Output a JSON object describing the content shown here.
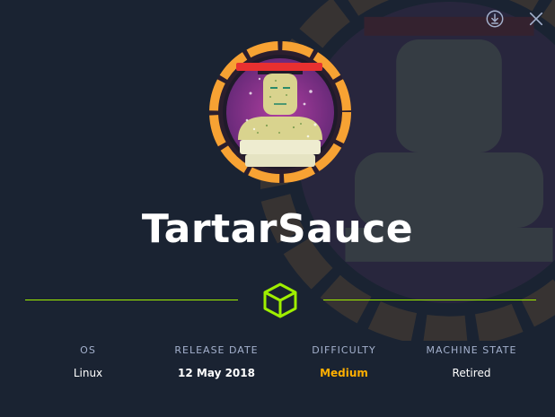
{
  "machine": {
    "name": "TartarSauce"
  },
  "stats": [
    {
      "label": "OS",
      "value": "Linux"
    },
    {
      "label": "RELEASE DATE",
      "value": "12 May 2018"
    },
    {
      "label": "DIFFICULTY",
      "value": "Medium"
    },
    {
      "label": "MACHINE STATE",
      "value": "Retired"
    }
  ],
  "icons": {
    "download": "download-icon",
    "close": "close-icon",
    "cube": "cube-icon"
  },
  "colors": {
    "background": "#1a2332",
    "accent_green": "#9fef00",
    "difficulty_medium": "#ffaf00",
    "label_gray": "#a4b1cd",
    "avatar_ring": "#f7a233"
  }
}
